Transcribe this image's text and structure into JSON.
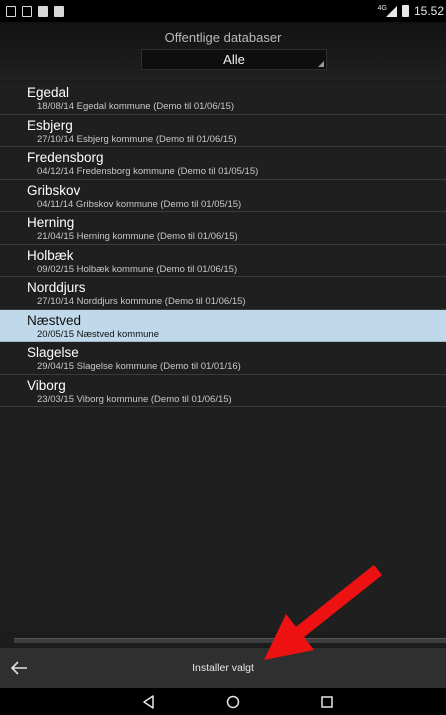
{
  "status_bar": {
    "time": "15.52",
    "network": "4G"
  },
  "header": {
    "title": "Offentlige databaser",
    "filter": {
      "selected": "Alle"
    }
  },
  "databases": [
    {
      "name": "Egedal",
      "detail": "18/08/14 Egedal kommune (Demo til 01/06/15)",
      "selected": false
    },
    {
      "name": "Esbjerg",
      "detail": "27/10/14 Esbjerg kommune (Demo til 01/06/15)",
      "selected": false
    },
    {
      "name": "Fredensborg",
      "detail": "04/12/14 Fredensborg kommune (Demo til 01/05/15)",
      "selected": false
    },
    {
      "name": "Gribskov",
      "detail": "04/11/14 Gribskov kommune (Demo til 01/05/15)",
      "selected": false
    },
    {
      "name": "Herning",
      "detail": "21/04/15 Herning kommune (Demo til 01/06/15)",
      "selected": false
    },
    {
      "name": "Holbæk",
      "detail": "09/02/15 Holbæk kommune (Demo til 01/06/15)",
      "selected": false
    },
    {
      "name": "Norddjurs",
      "detail": "27/10/14 Norddjurs kommune (Demo til 01/06/15)",
      "selected": false
    },
    {
      "name": "Næstved",
      "detail": "20/05/15 Næstved kommune",
      "selected": true
    },
    {
      "name": "Slagelse",
      "detail": "29/04/15 Slagelse kommune (Demo til 01/01/16)",
      "selected": false
    },
    {
      "name": "Viborg",
      "detail": "23/03/15 Viborg kommune (Demo til 01/06/15)",
      "selected": false
    }
  ],
  "action_bar": {
    "install_label": "Installer valgt"
  },
  "colors": {
    "selected_row": "#bfd8ea",
    "annotation_arrow": "#ee1111"
  }
}
